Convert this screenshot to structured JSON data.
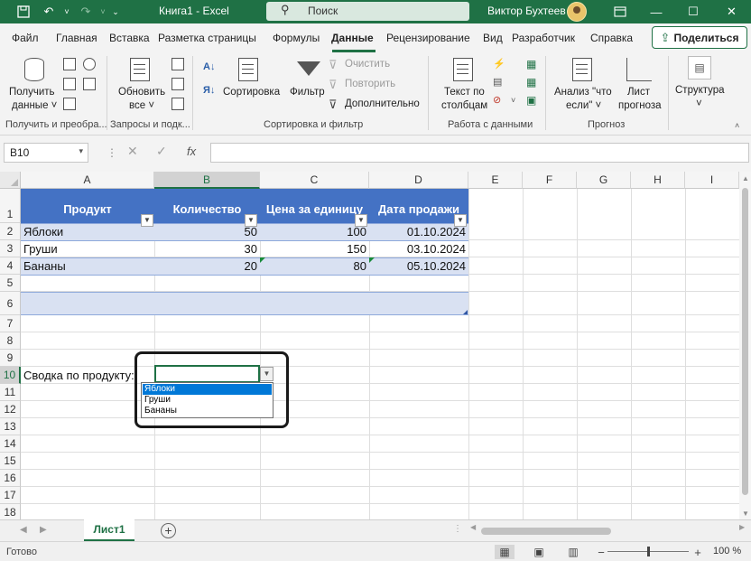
{
  "titlebar": {
    "title": "Книга1  -  Excel",
    "search_placeholder": "Поиск",
    "user": "Виктор Бухтеев",
    "icons": [
      "save-icon",
      "undo-icon",
      "redo-icon",
      "customize-icon",
      "search-icon",
      "ribbon-display-icon",
      "minimize-icon",
      "maximize-icon",
      "close-icon"
    ]
  },
  "menu": {
    "tabs": [
      "Файл",
      "Главная",
      "Вставка",
      "Разметка страницы",
      "Формулы",
      "Данные",
      "Рецензирование",
      "Вид",
      "Разработчик",
      "Справка"
    ],
    "active_tab": "Данные",
    "share_label": "Поделиться"
  },
  "ribbon": {
    "get_data": {
      "line1": "Получить",
      "line2": "данные ˅",
      "group": "Получить и преобра..."
    },
    "refresh": {
      "line1": "Обновить",
      "line2": "все ˅",
      "group": "Запросы и подк..."
    },
    "sort_filter": {
      "sort": "Сортировка",
      "filter": "Фильтр",
      "clear": "Очистить",
      "reapply": "Повторить",
      "advanced": "Дополнительно",
      "group": "Сортировка и фильтр"
    },
    "data_tools": {
      "line1": "Текст по",
      "line2": "столбцам",
      "group": "Работа с данными"
    },
    "forecast": {
      "whatif_line1": "Анализ \"что",
      "whatif_line2": "если\" ˅",
      "sheet_line1": "Лист",
      "sheet_line2": "прогноза",
      "group": "Прогноз"
    },
    "outline": {
      "line1": "Структура",
      "line2": "˅"
    }
  },
  "formula_bar": {
    "name_box": "B10",
    "fx": "fx",
    "value": ""
  },
  "grid": {
    "columns": [
      "A",
      "B",
      "C",
      "D",
      "E",
      "F",
      "G",
      "H",
      "I"
    ],
    "rows": [
      "1",
      "2",
      "3",
      "4",
      "5",
      "6",
      "7",
      "8",
      "9",
      "10",
      "11",
      "12",
      "13",
      "14",
      "15",
      "16",
      "17",
      "18"
    ],
    "table": {
      "headers": [
        "Продукт",
        "Количество",
        "Цена за единицу",
        "Дата продажи"
      ],
      "rows": [
        [
          "Яблоки",
          "50",
          "100",
          "01.10.2024"
        ],
        [
          "Груши",
          "30",
          "150",
          "03.10.2024"
        ],
        [
          "Бананы",
          "20",
          "80",
          "05.10.2024"
        ]
      ]
    },
    "summary_label": "Сводка по продукту:",
    "dropdown": {
      "options": [
        "Яблоки",
        "Груши",
        "Бананы"
      ],
      "highlighted": "Яблоки"
    }
  },
  "sheets": {
    "tabs": [
      "Лист1"
    ],
    "add_label": "+"
  },
  "status": {
    "text": "Готово",
    "zoom": "100 %",
    "minus": "−",
    "plus": "+"
  },
  "colors": {
    "excel_green": "#1f7145",
    "table_header": "#4472c4",
    "table_band": "#d9e1f2",
    "dropdown_highlight": "#0078d7"
  }
}
